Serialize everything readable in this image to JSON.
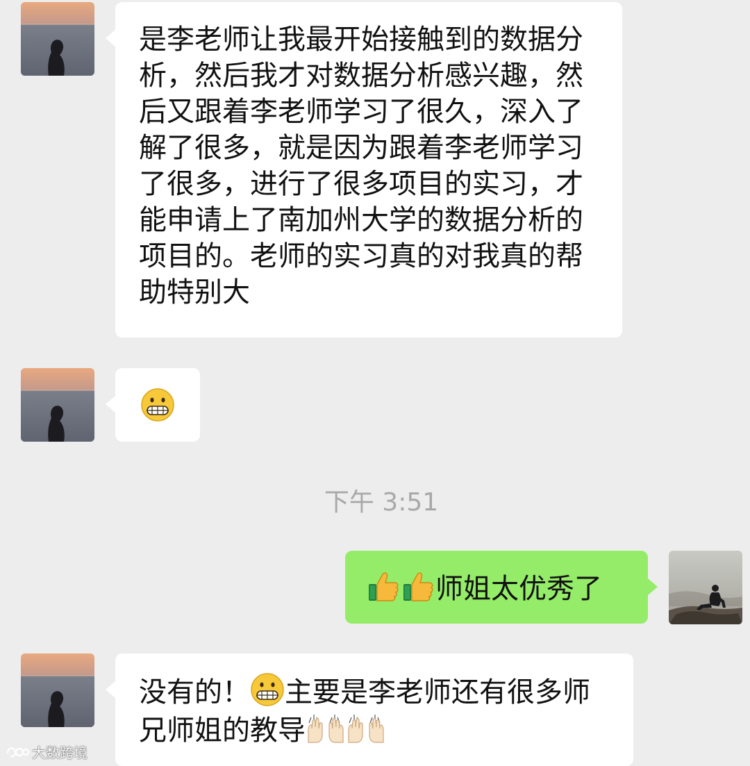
{
  "messages": [
    {
      "direction": "in",
      "text": "是李老师让我最开始接触到的数据分析，然后我才对数据分析感兴趣，然后又跟着李老师学习了很久，深入了解了很多，就是因为跟着李老师学习了很多，进行了很多项目的实习，才能申请上了南加州大学的数据分析的项目的。老师的实习真的对我真的帮助特别大"
    },
    {
      "direction": "in",
      "emoji": "grimacing-face"
    },
    {
      "direction": "out",
      "emoji": "thumbs-up",
      "text": "师姐太优秀了"
    },
    {
      "direction": "in",
      "text_a": "没有的！",
      "emoji": "grimacing-face",
      "text_b": "主要是李老师还有很多师兄师姐的教导",
      "trailing_emoji": "raising-hands"
    }
  ],
  "timestamp": "下午 3:51",
  "watermark": "大数跨境",
  "icons": {
    "avatar_in": "woman-silhouette-sunset-avatar",
    "avatar_out": "person-sitting-on-rock-avatar"
  },
  "colors": {
    "background": "#ededed",
    "incoming_bubble": "#ffffff",
    "outgoing_bubble": "#95ec69",
    "timestamp_text": "#a8a8a8"
  }
}
